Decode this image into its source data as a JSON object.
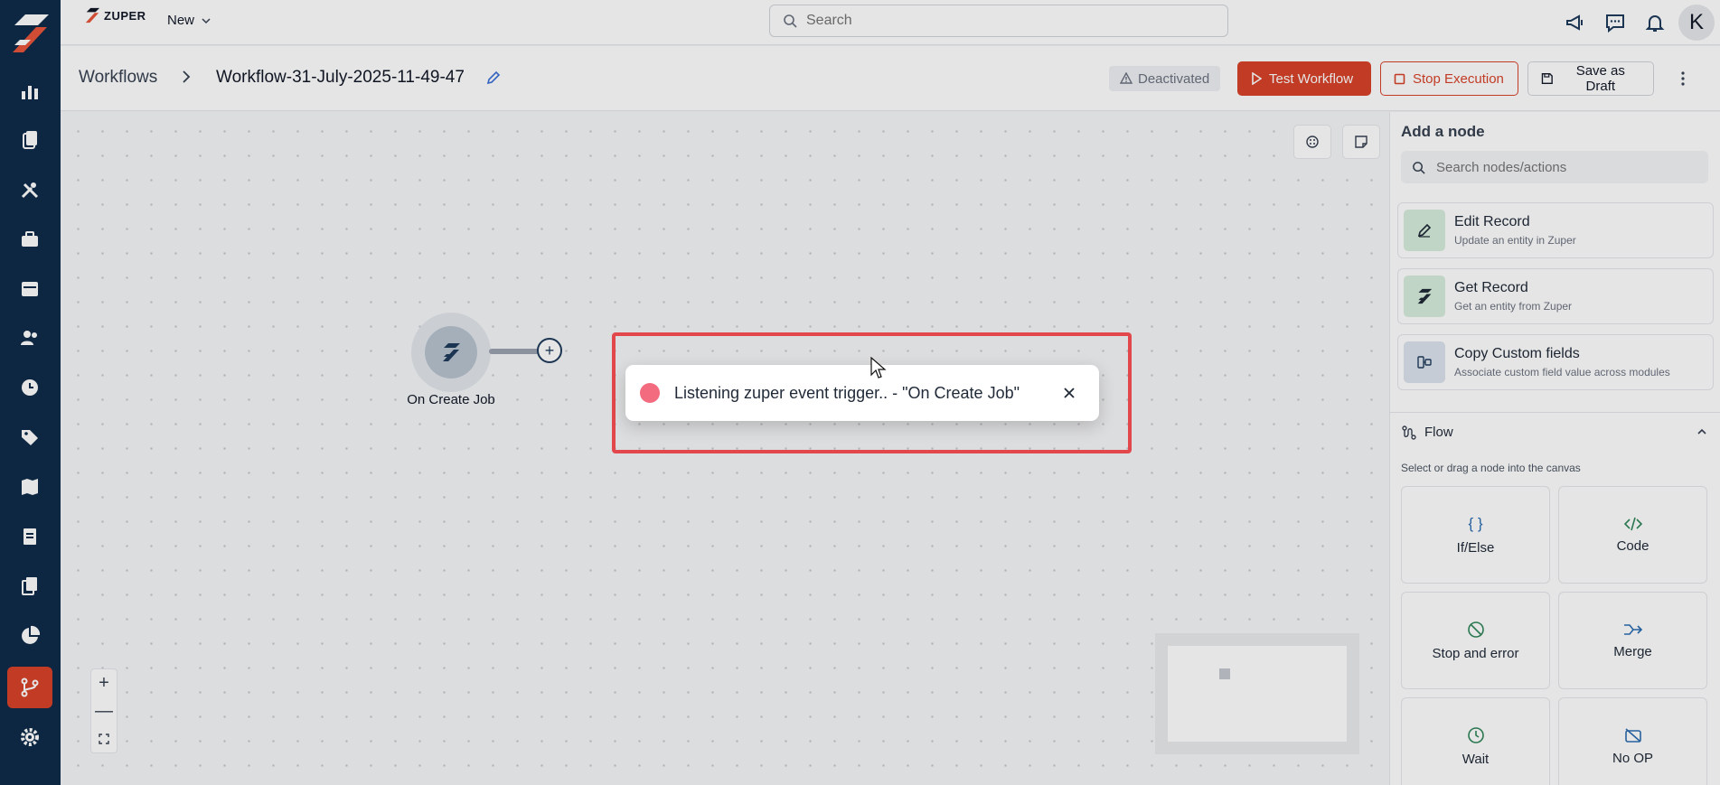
{
  "colors": {
    "accent": "#d9432a",
    "nav_bg": "#0f2c4a",
    "toast_dot": "#f26b7e",
    "highlight": "#e2474b"
  },
  "topbar": {
    "brand": "ZUPER",
    "new_label": "New",
    "search_placeholder": "Search"
  },
  "left_nav": {
    "items": [
      "dashboard-icon",
      "clipboard-icon",
      "tools-icon",
      "briefcase-icon",
      "calendar-icon",
      "users-icon",
      "clock-icon",
      "tag-icon",
      "map-icon",
      "invoice-icon",
      "documents-icon",
      "pie-chart-icon",
      "workflow-icon",
      "gear-icon"
    ],
    "active": "workflow-icon"
  },
  "header": {
    "breadcrumb_root": "Workflows",
    "workflow_name": "Workflow-31-July-2025-11-49-47",
    "status": "Deactivated",
    "test_button": "Test Workflow",
    "stop_button": "Stop Execution",
    "draft_button": "Save as Draft"
  },
  "canvas": {
    "trigger_node_label": "On Create Job"
  },
  "toast": {
    "message": "Listening zuper event trigger.. - \"On Create Job\""
  },
  "right_panel": {
    "title": "Add a node",
    "search_placeholder": "Search nodes/actions",
    "actions": [
      {
        "title": "Edit Record",
        "desc": "Update an entity in Zuper",
        "icon": "edit-icon"
      },
      {
        "title": "Get Record",
        "desc": "Get an entity from Zuper",
        "icon": "zuper-icon"
      },
      {
        "title": "Copy Custom fields",
        "desc": "Associate custom field value across modules",
        "icon": "copy-fields-icon"
      }
    ],
    "flow": {
      "title": "Flow",
      "hint": "Select or drag a node into the canvas",
      "items": [
        {
          "label": "If/Else",
          "icon": "braces-icon"
        },
        {
          "label": "Code",
          "icon": "code-icon"
        },
        {
          "label": "Stop and error",
          "icon": "stop-icon"
        },
        {
          "label": "Merge",
          "icon": "merge-icon"
        },
        {
          "label": "Wait",
          "icon": "wait-icon"
        },
        {
          "label": "No OP",
          "icon": "no-op-icon"
        }
      ]
    }
  }
}
